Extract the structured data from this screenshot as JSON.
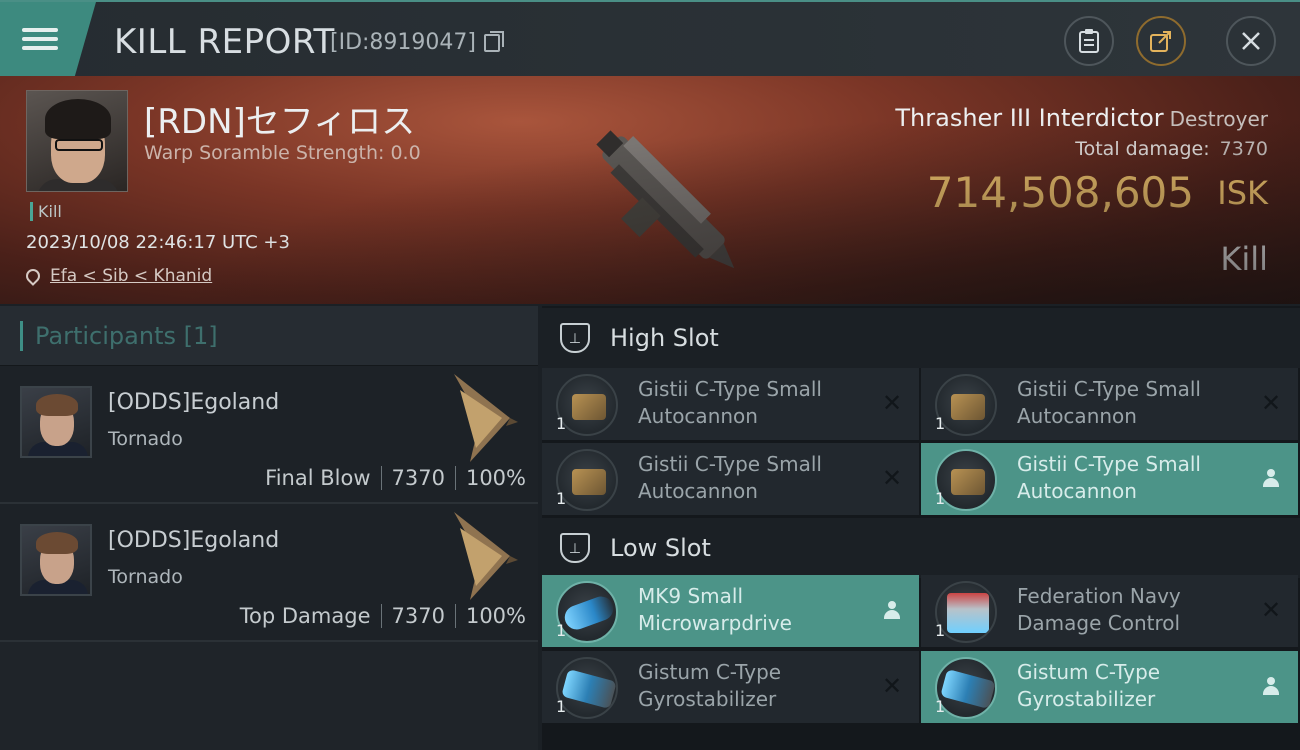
{
  "topbar": {
    "title": "KILL REPORT",
    "report_id": "[ID:8919047]"
  },
  "victim": {
    "name": "[RDN]セフィロス",
    "scramble": "Warp Soramble Strength: 0.0",
    "tag": "Kill",
    "datetime": "2023/10/08 22:46:17 UTC +3",
    "location": "Efa < Sib < Khanid"
  },
  "loss": {
    "ship": "Thrasher III Interdictor",
    "ship_class": "Destroyer",
    "total_damage_label": "Total damage:",
    "total_damage": "7370",
    "isk_value": "714,508,605",
    "isk_label": "ISK",
    "result": "Kill"
  },
  "participants": {
    "header": "Participants [1]",
    "rows": [
      {
        "name": "[ODDS]Egoland",
        "ship": "Tornado",
        "role": "Final Blow",
        "damage": "7370",
        "percent": "100%"
      },
      {
        "name": "[ODDS]Egoland",
        "ship": "Tornado",
        "role": "Top Damage",
        "damage": "7370",
        "percent": "100%"
      }
    ]
  },
  "fitting": {
    "high_slot": {
      "title": "High Slot",
      "modules": [
        {
          "line1": "Gistii C-Type Small",
          "line2": "Autocannon",
          "qty": "1",
          "status": "destroyed"
        },
        {
          "line1": "Gistii C-Type Small",
          "line2": "Autocannon",
          "qty": "1",
          "status": "destroyed"
        },
        {
          "line1": "Gistii C-Type Small",
          "line2": "Autocannon",
          "qty": "1",
          "status": "destroyed"
        },
        {
          "line1": "Gistii C-Type Small",
          "line2": "Autocannon",
          "qty": "1",
          "status": "dropped"
        }
      ]
    },
    "low_slot": {
      "title": "Low Slot",
      "modules": [
        {
          "line1": "MK9 Small",
          "line2": "Microwarpdrive",
          "qty": "1",
          "status": "dropped"
        },
        {
          "line1": "Federation Navy",
          "line2": "Damage Control",
          "qty": "1",
          "status": "destroyed"
        },
        {
          "line1": "Gistum C-Type",
          "line2": "Gyrostabilizer",
          "qty": "1",
          "status": "destroyed"
        },
        {
          "line1": "Gistum C-Type",
          "line2": "Gyrostabilizer",
          "qty": "1",
          "status": "dropped"
        }
      ]
    }
  },
  "colors": {
    "accent": "#3e8f86",
    "isk": "#f0c36d",
    "dropped_bg": "#4c9488"
  }
}
